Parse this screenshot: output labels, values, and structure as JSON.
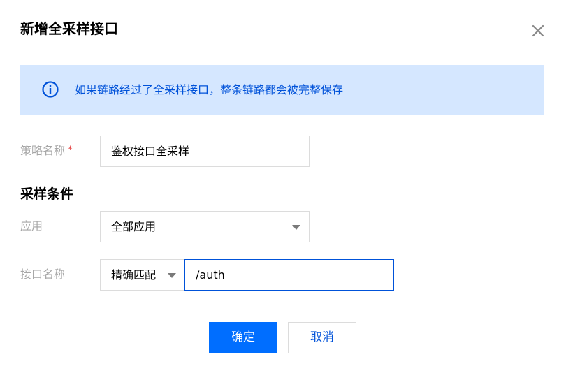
{
  "dialog": {
    "title": "新增全采样接口"
  },
  "info": {
    "icon": "info-icon",
    "text": "如果链路经过了全采样接口，整条链路都会被完整保存",
    "color": "#0052d9",
    "background": "#d5e7ff"
  },
  "form": {
    "strategy_name": {
      "label": "策略名称",
      "required_mark": "*",
      "value": "鉴权接口全采样"
    },
    "section_title": "采样条件",
    "application": {
      "label": "应用",
      "selected": "全部应用"
    },
    "interface_name": {
      "label": "接口名称",
      "match_mode": "精确匹配",
      "value": "/auth"
    }
  },
  "buttons": {
    "confirm": "确定",
    "cancel": "取消"
  },
  "colors": {
    "primary": "#006eff",
    "link": "#0052d9",
    "label": "#a6a6a6",
    "required": "#e54545",
    "border": "#dcdcdc"
  }
}
